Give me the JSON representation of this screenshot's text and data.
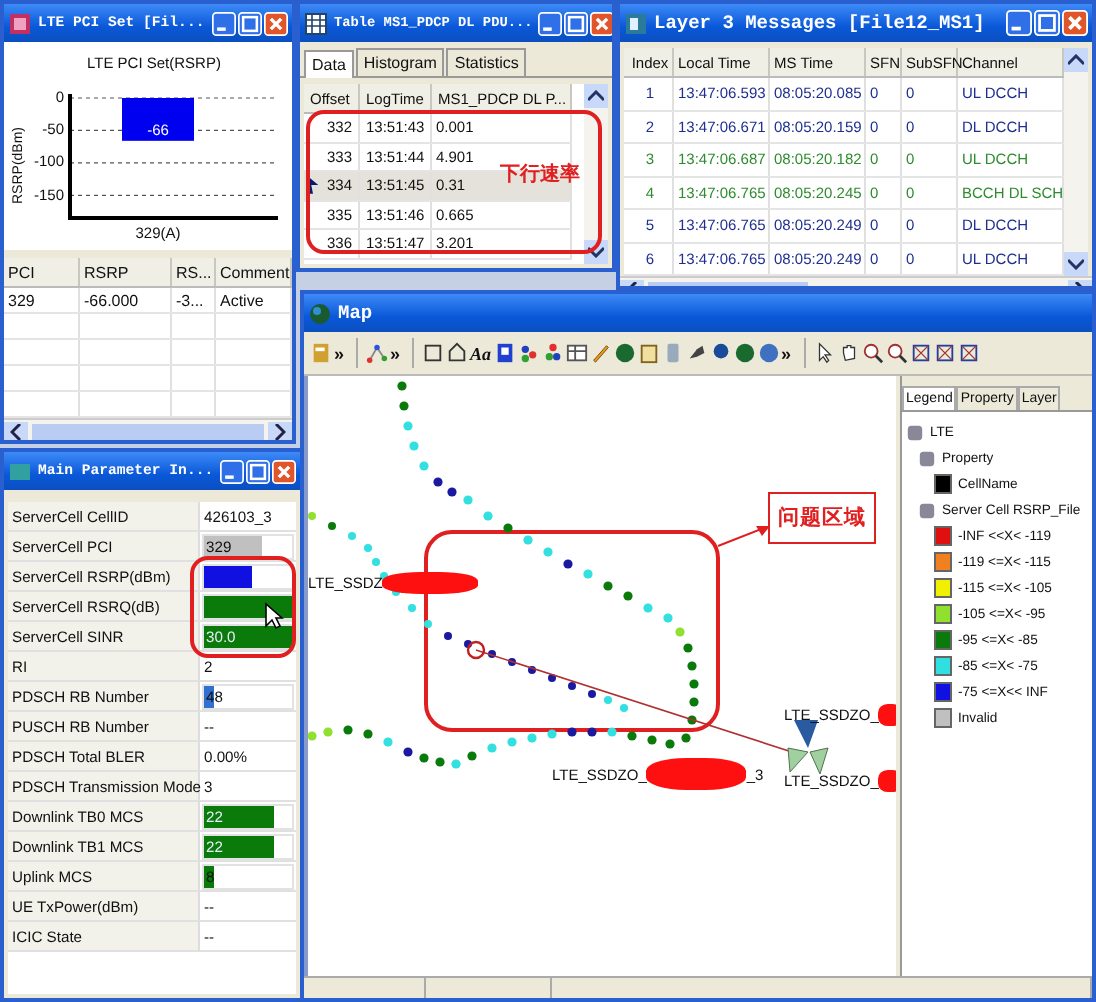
{
  "pci_window": {
    "title": "LTE PCI Set [Fil...",
    "chart_data": {
      "type": "bar",
      "title": "LTE PCI Set(RSRP)",
      "ylabel": "RSRP(dBm)",
      "categories": [
        "329(A)"
      ],
      "values": [
        -66
      ],
      "ylim": [
        -185,
        0
      ],
      "yticks": [
        0,
        -50,
        -100,
        -150
      ],
      "data_labels": true,
      "grid": true
    },
    "columns": [
      "PCI",
      "RSRP",
      "RS...",
      "Comment"
    ],
    "rows": [
      [
        "329",
        "-66.000",
        "-3...",
        "Active"
      ]
    ]
  },
  "pdcp_window": {
    "title": "Table MS1_PDCP DL PDU...",
    "tabs": [
      {
        "label": "Data",
        "selected": true
      },
      {
        "label": "Histogram",
        "selected": false
      },
      {
        "label": "Statistics",
        "selected": false
      }
    ],
    "columns": [
      "Offset",
      "LogTime",
      "MS1_PDCP DL P..."
    ],
    "rows": [
      {
        "cells": [
          "332",
          "13:51:43",
          "0.001"
        ],
        "selected": false
      },
      {
        "cells": [
          "333",
          "13:51:44",
          "4.901"
        ],
        "selected": false
      },
      {
        "cells": [
          "334",
          "13:51:45",
          "0.31"
        ],
        "selected": true
      },
      {
        "cells": [
          "335",
          "13:51:46",
          "0.665"
        ],
        "selected": false
      },
      {
        "cells": [
          "336",
          "13:51:47",
          "3.201"
        ],
        "selected": false
      }
    ],
    "annotation": "下行速率"
  },
  "l3_window": {
    "title": "Layer 3 Messages [File12_MS1]",
    "columns": [
      "Index",
      "Local Time",
      "MS Time",
      "SFN",
      "SubSFN",
      "Channel"
    ],
    "rows": [
      {
        "cells": [
          "1",
          "13:47:06.593",
          "08:05:20.085",
          "0",
          "0",
          "UL DCCH"
        ],
        "color": "#1f2f8f"
      },
      {
        "cells": [
          "2",
          "13:47:06.671",
          "08:05:20.159",
          "0",
          "0",
          "DL DCCH"
        ],
        "color": "#1f2f8f"
      },
      {
        "cells": [
          "3",
          "13:47:06.687",
          "08:05:20.182",
          "0",
          "0",
          "UL DCCH"
        ],
        "color": "#2e8b2e"
      },
      {
        "cells": [
          "4",
          "13:47:06.765",
          "08:05:20.245",
          "0",
          "0",
          "BCCH DL SCH"
        ],
        "color": "#2e8b2e"
      },
      {
        "cells": [
          "5",
          "13:47:06.765",
          "08:05:20.249",
          "0",
          "0",
          "DL DCCH"
        ],
        "color": "#1f2f8f"
      },
      {
        "cells": [
          "6",
          "13:47:06.765",
          "08:05:20.249",
          "0",
          "0",
          "UL DCCH"
        ],
        "color": "#1f2f8f"
      }
    ]
  },
  "param_window": {
    "title": "Main Parameter In...",
    "rows": [
      {
        "label": "ServerCell CellID",
        "kind": "text",
        "value": "426103_3"
      },
      {
        "label": "ServerCell PCI",
        "kind": "bar",
        "value": "329",
        "level": 0.65,
        "color": "#c0c0c0"
      },
      {
        "label": "ServerCell RSRP(dBm)",
        "kind": "bar",
        "level": 0.55,
        "color": "#1010e0"
      },
      {
        "label": "ServerCell RSRQ(dB)",
        "kind": "bar",
        "level": 1,
        "color": "#0a7a0a"
      },
      {
        "label": "ServerCell SINR",
        "kind": "bar",
        "value": "30.0",
        "level": 1,
        "color": "#0a7a0a"
      },
      {
        "label": "RI",
        "kind": "text",
        "value": "2"
      },
      {
        "label": "PDSCH RB Number",
        "kind": "bar",
        "value": "48",
        "level": 0.12,
        "color": "#3070d0"
      },
      {
        "label": "PUSCH RB Number",
        "kind": "text",
        "value": "--"
      },
      {
        "label": "PDSCH Total BLER",
        "kind": "text",
        "value": "0.00%"
      },
      {
        "label": "PDSCH Transmission Mode",
        "kind": "text",
        "value": "3"
      },
      {
        "label": "Downlink TB0 MCS",
        "kind": "bar",
        "value": "22",
        "level": 0.8,
        "color": "#0a7a0a"
      },
      {
        "label": "Downlink TB1 MCS",
        "kind": "bar",
        "value": "22",
        "level": 0.8,
        "color": "#0a7a0a"
      },
      {
        "label": "Uplink MCS",
        "kind": "bar",
        "value": "8",
        "level": 0.12,
        "color": "#0a7a0a"
      },
      {
        "label": "UE TxPower(dBm)",
        "kind": "text",
        "value": "--"
      },
      {
        "label": "ICIC State",
        "kind": "text",
        "value": "--"
      }
    ]
  },
  "map_window": {
    "title": "Map",
    "toolbar": {
      "overflow": [
        "»",
        "»",
        "»"
      ],
      "font_tool": "Aa"
    },
    "cell_labels": [
      "LTE_SSDZ",
      "LTE_SSDZO_",
      "LTE_SSDZO_",
      "_3",
      "LTE_SSDZO_"
    ],
    "annotation": "问题区域",
    "legend_tabs": [
      {
        "label": "Legend",
        "selected": true
      },
      {
        "label": "Property",
        "selected": false
      },
      {
        "label": "Layer",
        "selected": false
      }
    ],
    "legend_tree": {
      "label": "LTE",
      "children": [
        {
          "label": "Property",
          "children": [
            {
              "label": "CellName",
              "color": "#000000"
            }
          ]
        },
        {
          "label": "Server Cell RSRP_File",
          "children": [
            {
              "label": "-INF <<X< -119",
              "color": "#e01010"
            },
            {
              "label": "-119 <=X< -115",
              "color": "#f08020"
            },
            {
              "label": "-115 <=X< -105",
              "color": "#f0f000"
            },
            {
              "label": "-105 <=X< -95",
              "color": "#90e030"
            },
            {
              "label": "-95 <=X< -85",
              "color": "#0a7a0a"
            },
            {
              "label": "-85 <=X< -75",
              "color": "#30e0e0"
            },
            {
              "label": "-75 <=X<< INF",
              "color": "#1010e0"
            },
            {
              "label": "Invalid",
              "color": "#c0c0c0"
            }
          ]
        }
      ]
    }
  }
}
